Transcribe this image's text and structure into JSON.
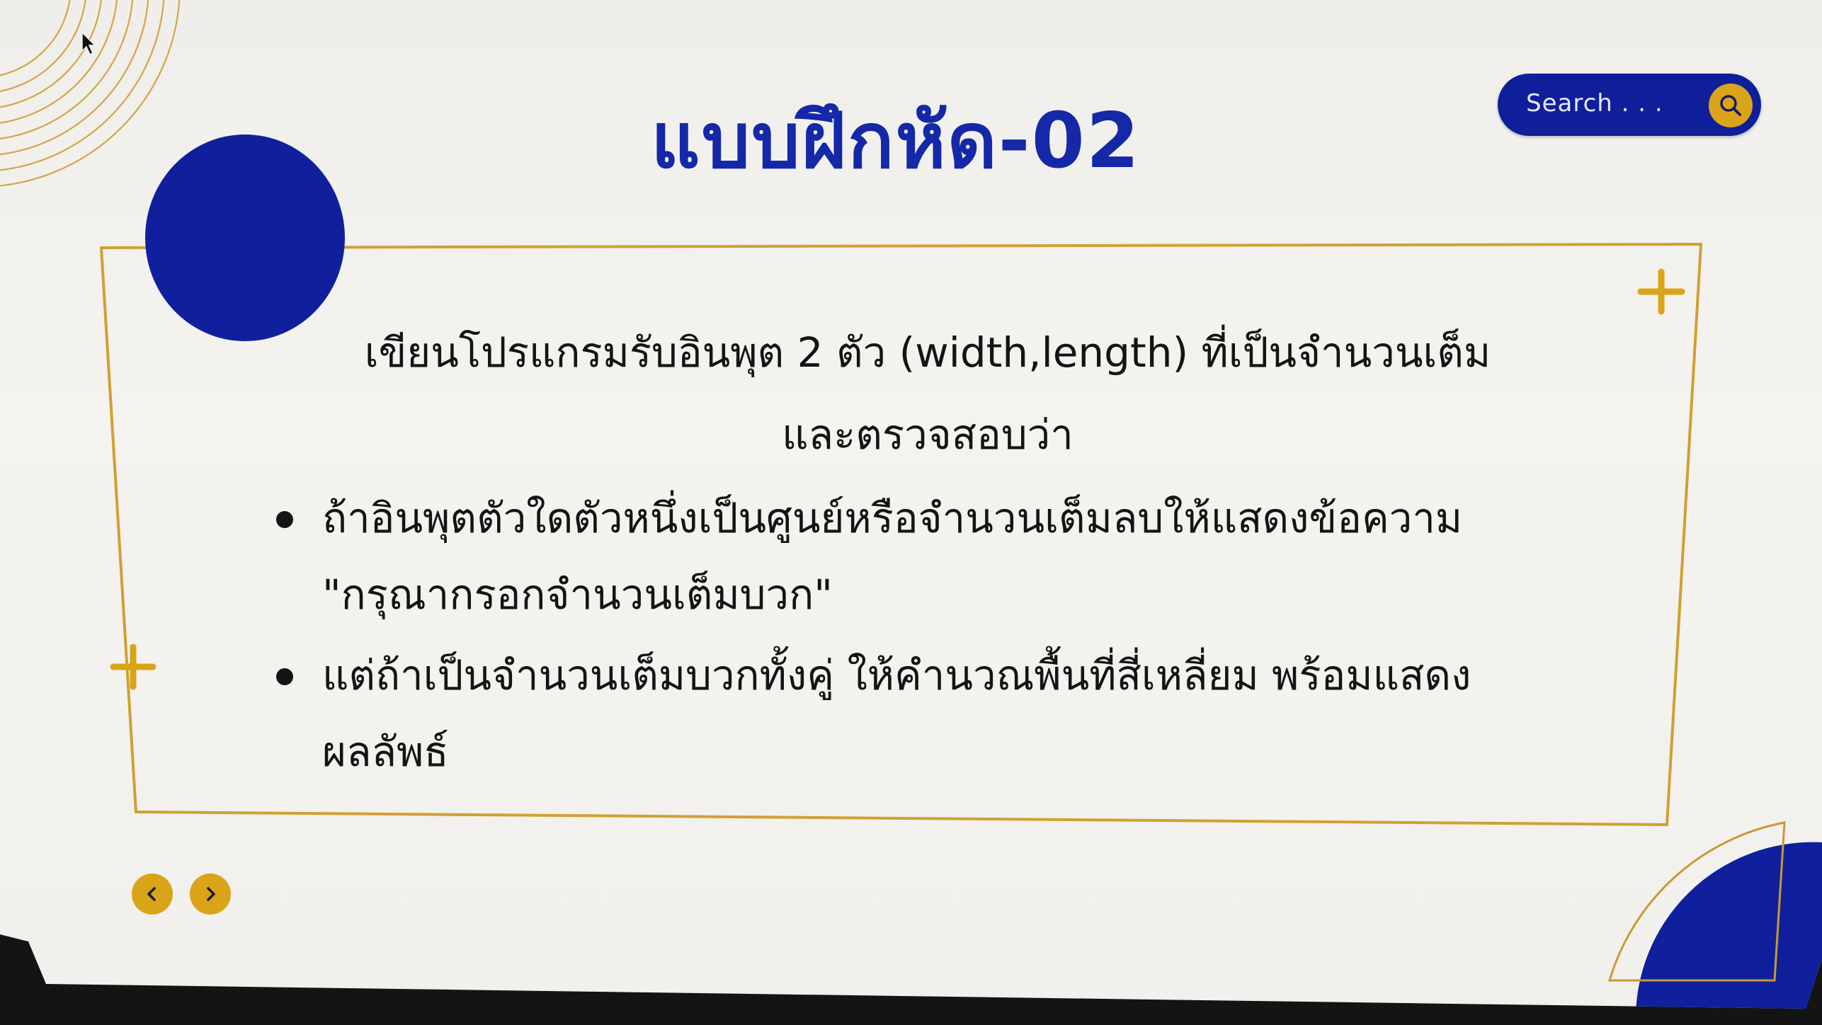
{
  "slide": {
    "title": "แบบฝึกหัด-02",
    "intro_line1": "เขียนโปรแกรมรับอินพุต 2 ตัว (width,length) ที่เป็นจำนวนเต็ม",
    "intro_line2": "และตรวจสอบว่า",
    "bullets": [
      {
        "line1": "ถ้าอินพุตตัวใดตัวหนึ่งเป็นศูนย์หรือจำนวนเต็มลบให้แสดงข้อความ",
        "line2": "\"กรุณากรอกจำนวนเต็มบวก\""
      },
      {
        "line1": "แต่ถ้าเป็นจำนวนเต็มบวกทั้งคู่  ให้คำนวณพื้นที่สี่เหลี่ยม   พร้อมแสดง",
        "line2": "ผลลัพธ์"
      }
    ]
  },
  "search": {
    "placeholder": "Search . . .",
    "icon": "search-icon"
  },
  "navigation": {
    "prev_icon": "chevron-left-icon",
    "next_icon": "chevron-right-icon"
  },
  "colors": {
    "navy": "#10209c",
    "gold": "#d9a418",
    "background": "#f2f1ed",
    "text": "#141414"
  }
}
